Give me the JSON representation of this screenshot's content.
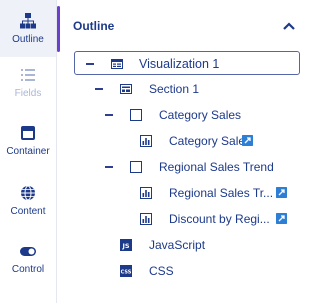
{
  "rail": {
    "items": [
      {
        "label": "Outline",
        "icon": "hierarchy-icon",
        "state": "active"
      },
      {
        "label": "Fields",
        "icon": "list-icon",
        "state": "disabled"
      },
      {
        "label": "Container",
        "icon": "container-icon",
        "state": "normal"
      },
      {
        "label": "Content",
        "icon": "globe-icon",
        "state": "normal"
      },
      {
        "label": "Control",
        "icon": "toggle-icon",
        "state": "normal"
      }
    ]
  },
  "outline": {
    "title": "Outline",
    "collapse_icon": "chevron-up-icon",
    "nodes": [
      {
        "label": "Visualization 1",
        "icon": "visualization-icon",
        "expanded": true,
        "selected": true
      },
      {
        "label": "Section 1",
        "icon": "section-icon",
        "expanded": true
      },
      {
        "label": "Category Sales",
        "icon": "container-box-icon",
        "expanded": true
      },
      {
        "label": "Category Sales",
        "icon": "chart-icon",
        "has_link": true
      },
      {
        "label": "Regional Sales Trend",
        "icon": "container-box-icon",
        "expanded": true
      },
      {
        "label": "Regional Sales Tr...",
        "icon": "chart-icon",
        "has_link": true
      },
      {
        "label": "Discount by Regi...",
        "icon": "chart-icon",
        "has_link": true
      },
      {
        "label": "JavaScript",
        "icon": "javascript-icon"
      },
      {
        "label": "CSS",
        "icon": "css-icon"
      }
    ]
  },
  "colors": {
    "text": "#1d3a8a",
    "disabled_text": "#aab6d6",
    "accent": "#6b3fd0",
    "link_badge": "#2d7fd6",
    "rail_active_bg": "#eef1f7"
  }
}
